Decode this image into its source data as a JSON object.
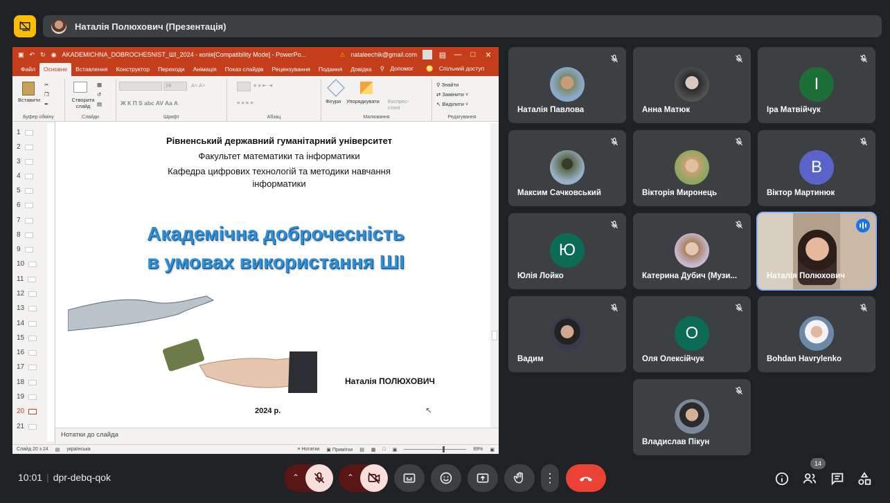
{
  "top": {
    "presenter_label": "Наталія Полюхович (Презентація)"
  },
  "ppt": {
    "title_file": "AKADEMICHNA_DOBROCHESNIST_ШІ_2024 - копія[Compatibility Mode] - PowerPo...",
    "account": "nataleechik@gmail.com",
    "tabs": [
      "Файл",
      "Основне",
      "Вставлення",
      "Конструктор",
      "Переходи",
      "Анімація",
      "Показ слайдів",
      "Рецензування",
      "Подання",
      "Довідка",
      "Допомог",
      "Спільний доступ"
    ],
    "ribbon": {
      "paste": "Вставити",
      "create_slide": "Створити слайд",
      "clipboard": "Буфер обміну",
      "slides": "Слайди",
      "font": "Шрифт",
      "paragraph": "Абзац",
      "shapes": "Фігури",
      "arrange": "Упорядкувати",
      "express": "Експрес-стилі",
      "drawing": "Малювання",
      "find": "Знайти",
      "replace": "Замінити",
      "select": "Виділити",
      "editing": "Редагування",
      "font_size": "28"
    },
    "slide_numbers": [
      "1",
      "2",
      "3",
      "4",
      "5",
      "6",
      "7",
      "8",
      "9",
      "10",
      "11",
      "12",
      "13",
      "14",
      "15",
      "16",
      "17",
      "18",
      "19",
      "20",
      "21"
    ],
    "selected_slide": "20",
    "slide": {
      "university": "Рівненський державний гуманітарний університет",
      "faculty": "Факультет математики та інформатики",
      "department_line1": "Кафедра цифрових технологій та методики навчання",
      "department_line2": "інформатики",
      "title_line1": "Академічна доброчесність",
      "title_line2": "в умовах використання ШІ",
      "author": "Наталія ПОЛЮХОВИЧ",
      "year": "2024 р."
    },
    "notes_placeholder": "Нотатки до слайда",
    "status": {
      "slide_count": "Слайд 20 з 24",
      "language": "українська",
      "notes": "Нотатки",
      "comments": "Примітки",
      "zoom": "89%"
    }
  },
  "participants": [
    {
      "name": "Наталія Павлова",
      "initial": ""
    },
    {
      "name": "Анна Матюк",
      "initial": ""
    },
    {
      "name": "Іра Матвійчук",
      "initial": "І"
    },
    {
      "name": "Максим Сачковський",
      "initial": ""
    },
    {
      "name": "Вікторія Миронець",
      "initial": ""
    },
    {
      "name": "Віктор Мартинюк",
      "initial": "В"
    },
    {
      "name": "Юлія Лойко",
      "initial": "Ю"
    },
    {
      "name": "Катерина Дубич (Музи...",
      "initial": ""
    },
    {
      "name": "Наталія Полюхович",
      "initial": ""
    },
    {
      "name": "Вадим",
      "initial": ""
    },
    {
      "name": "Оля Олексійчук",
      "initial": "О"
    },
    {
      "name": "Bohdan Havrylenko",
      "initial": ""
    },
    {
      "name": "Владислав Пікун",
      "initial": ""
    }
  ],
  "colors": {
    "avatar_green": "#1e6f37",
    "avatar_purple": "#5b63c8",
    "avatar_teal": "#0b6b57",
    "hangup": "#ea4335"
  },
  "bottom": {
    "time": "10:01",
    "meeting_code": "dpr-debq-qok",
    "participant_count": "14"
  }
}
